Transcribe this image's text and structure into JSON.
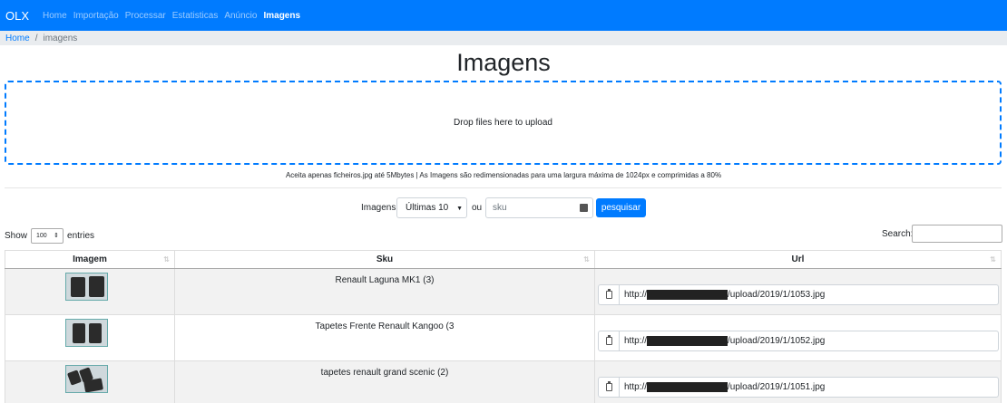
{
  "nav": {
    "brand": "OLX",
    "items": [
      "Home",
      "Importação",
      "Processar",
      "Estatisticas",
      "Anúncio",
      "Imagens"
    ],
    "active_index": 5
  },
  "breadcrumb": {
    "home": "Home",
    "sep": "/",
    "current": "imagens"
  },
  "title": "Imagens",
  "dropzone": {
    "text": "Drop files here to upload"
  },
  "upload_note": "Aceita apenas ficheiros.jpg até 5Mbytes | As Imagens são redimensionadas para uma largura máxima de 1024px e comprimidas a 80%",
  "filter": {
    "label": "Imagens",
    "select_value": "Últimas 10",
    "ou": "ou",
    "sku_placeholder": "sku",
    "button": "pesquisar"
  },
  "datatable": {
    "show": "Show",
    "entries_value": "100",
    "entries": "entries",
    "search_label": "Search:"
  },
  "table": {
    "columns": [
      "Imagem",
      "Sku",
      "Url"
    ],
    "rows": [
      {
        "sku": "Renault Laguna MK1 (3)",
        "url_prefix": "http://",
        "url_suffix": "/upload/2019/1/1053.jpg"
      },
      {
        "sku": "Tapetes Frente Renault Kangoo (3",
        "url_prefix": "http://",
        "url_suffix": "/upload/2019/1/1052.jpg"
      },
      {
        "sku": "tapetes renault grand scenic (2)",
        "url_prefix": "http://",
        "url_suffix": "/upload/2019/1/1051.jpg"
      }
    ]
  },
  "colors": {
    "primary": "#007bff",
    "breadcrumb_bg": "#e9ecef"
  }
}
